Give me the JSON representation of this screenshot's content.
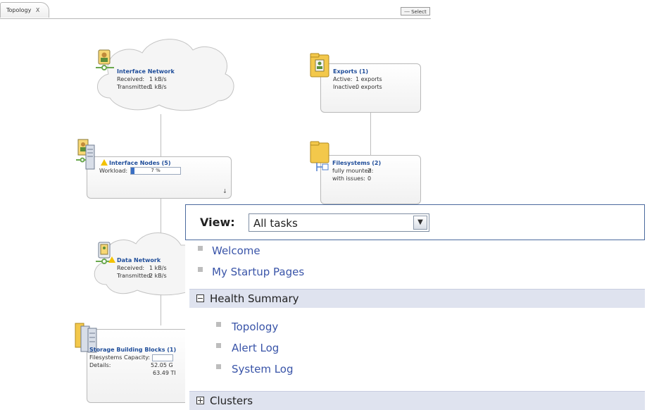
{
  "topology": {
    "tab_label": "Topology",
    "tab_close": "X",
    "select_button": "--- Select",
    "interface_network": {
      "title": "Interface Network",
      "received_label": "Received:",
      "received_value": "1 kB/s",
      "transmitted_label": "Transmitted:",
      "transmitted_value": "1 kB/s"
    },
    "exports": {
      "title": "Exports (1)",
      "active_label": "Active:",
      "active_value": "1 exports",
      "inactive_label": "Inactive:",
      "inactive_value": "0 exports"
    },
    "interface_nodes": {
      "title": "Interface Nodes (5)",
      "workload_label": "Workload:",
      "workload_value": "7 %",
      "workload_fraction": 0.07
    },
    "filesystems": {
      "title": "Filesystems (2)",
      "mounted_label": "fully mounted:",
      "mounted_value": "2",
      "issues_label": "with issues:",
      "issues_value": "0"
    },
    "data_network": {
      "title": "Data Network",
      "received_label": "Received:",
      "received_value": "1 kB/s",
      "transmitted_label": "Transmitted:",
      "transmitted_value": "2 kB/s"
    },
    "storage_blocks": {
      "title": "Storage Building Blocks (1)",
      "capacity_label": "Filesystems Capacity:",
      "details_label": "Details:",
      "details_value_1": "52.05 G",
      "details_value_2": "63.49 TI"
    }
  },
  "tasks": {
    "view_label": "View:",
    "view_value": "All tasks",
    "links": [
      "Welcome",
      "My Startup Pages"
    ],
    "health_summary": {
      "label": "Health Summary",
      "items": [
        "Topology",
        "Alert Log",
        "System Log"
      ]
    },
    "clusters_label": "Clusters"
  },
  "colors": {
    "link": "#3954a8",
    "section_bg": "#dfe3ef",
    "view_border": "#4b6a9e",
    "warning": "#f3c200"
  }
}
